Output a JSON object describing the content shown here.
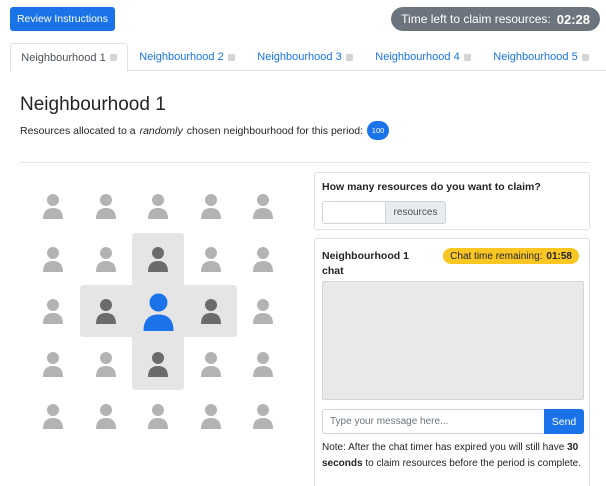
{
  "header": {
    "review_label": "Review Instructions",
    "timer_label": "Time left to claim resources:",
    "timer_value": "02:28"
  },
  "tabs": [
    {
      "label": "Neighbourhood 1",
      "active": true
    },
    {
      "label": "Neighbourhood 2",
      "active": false
    },
    {
      "label": "Neighbourhood 3",
      "active": false
    },
    {
      "label": "Neighbourhood 4",
      "active": false
    },
    {
      "label": "Neighbourhood 5",
      "active": false
    }
  ],
  "main": {
    "title": "Neighbourhood 1",
    "subtitle_before": "Resources allocated to a",
    "subtitle_emph": "randomly",
    "subtitle_after": "chosen neighbourhood for this period:",
    "resources_badge": "100"
  },
  "grid": {
    "rows": 5,
    "cols": 5,
    "self": [
      2,
      2
    ],
    "neighbours": [
      [
        1,
        2
      ],
      [
        2,
        1
      ],
      [
        2,
        3
      ],
      [
        3,
        2
      ]
    ],
    "colors": {
      "other": "#b3b3b3",
      "neighbour": "#6b6b6b",
      "self": "#1a73e8",
      "highlight": "#e5e5e5"
    },
    "icon": "person-icon"
  },
  "claim": {
    "question": "How many resources do you want to claim?",
    "input_value": "",
    "addon_label": "resources"
  },
  "chat": {
    "title": "Neighbourhood 1 chat",
    "timer_label": "Chat time remaining:",
    "timer_value": "01:58",
    "placeholder": "Type your message here...",
    "send_label": "Send",
    "note_before": "Note: After the chat timer has expired you will still have",
    "note_bold": "30 seconds",
    "note_after": "to claim resources before the period is complete."
  },
  "colors": {
    "accent": "#1a73e8",
    "chat_timer": "#f9c623",
    "timer_pill": "#6c757d"
  }
}
